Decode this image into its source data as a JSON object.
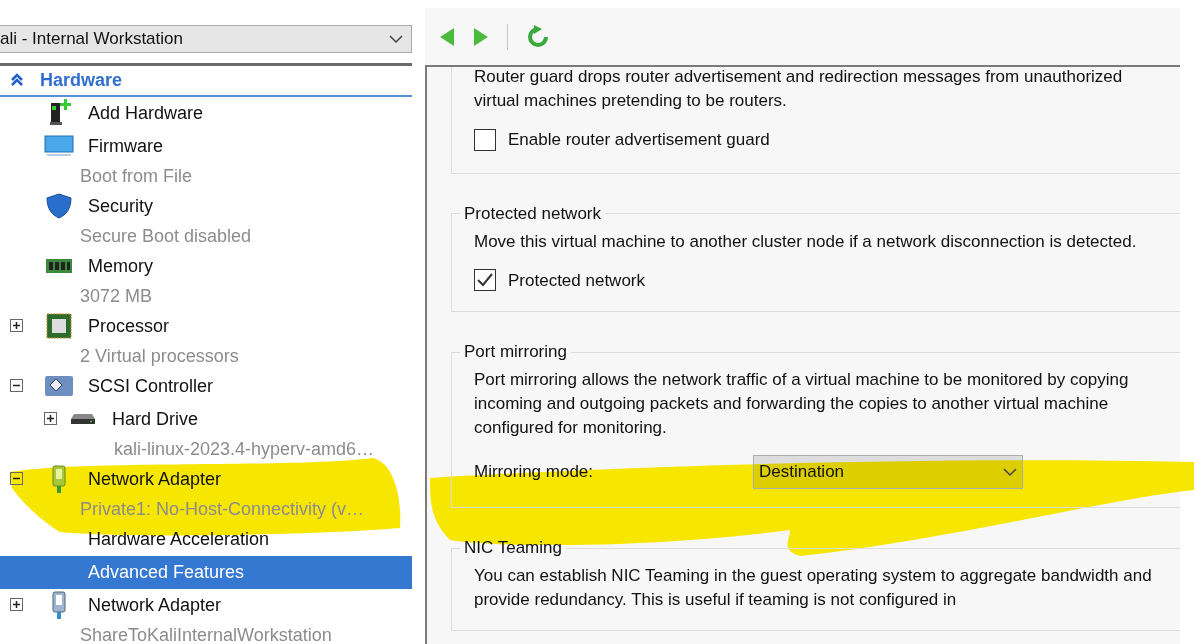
{
  "vm_selector": {
    "value": "ali - Internal Workstation"
  },
  "tree": {
    "section": {
      "label": "Hardware",
      "expanded": true
    },
    "items": [
      {
        "kind": "add-hardware",
        "label": "Add Hardware",
        "selected": false
      },
      {
        "kind": "firmware",
        "label": "Firmware",
        "detail": "Boot from File",
        "selected": false
      },
      {
        "kind": "security",
        "label": "Security",
        "detail": "Secure Boot disabled",
        "selected": false
      },
      {
        "kind": "memory",
        "label": "Memory",
        "detail": "3072 MB",
        "selected": false
      },
      {
        "kind": "processor",
        "label": "Processor",
        "detail": "2 Virtual processors",
        "expanded": false,
        "selected": false
      },
      {
        "kind": "controller",
        "label": "SCSI Controller",
        "expanded": true,
        "selected": false,
        "children": [
          {
            "kind": "drive",
            "label": "Hard Drive",
            "detail": "kali-linux-2023.4-hyperv-amd6…",
            "expanded": false,
            "selected": false
          }
        ]
      },
      {
        "kind": "network-adapter",
        "label": "Network Adapter",
        "detail": "Private1: No-Host-Connectivity (v…",
        "expanded": true,
        "selected": false,
        "children": [
          {
            "kind": "setting",
            "label": "Hardware Acceleration",
            "selected": false
          },
          {
            "kind": "setting",
            "label": "Advanced Features",
            "selected": true
          }
        ]
      },
      {
        "kind": "network-adapter",
        "label": "Network Adapter",
        "detail": "ShareToKaliInternalWorkstation",
        "expanded": false,
        "selected": false
      }
    ]
  },
  "settings": {
    "groups": [
      {
        "description": "Router guard drops router advertisement and redirection messages from unauthorized virtual machines pretending to be routers.",
        "controls": [
          {
            "kind": "checkbox",
            "label": "Enable router advertisement guard",
            "checked": false
          }
        ]
      },
      {
        "legend": "Protected network",
        "description": "Move this virtual machine to another cluster node if a network disconnection is detected.",
        "controls": [
          {
            "kind": "checkbox",
            "label": "Protected network",
            "checked": true
          }
        ]
      },
      {
        "legend": "Port mirroring",
        "description": "Port mirroring allows the network traffic of a virtual machine to be monitored by copying incoming and outgoing packets and forwarding the copies to another virtual machine configured for monitoring.",
        "controls": [
          {
            "kind": "dropdown",
            "label": "Mirroring mode:",
            "value": "Destination"
          }
        ]
      },
      {
        "legend": "NIC Teaming",
        "description": "You can establish NIC Teaming in the guest operating system to aggregate bandwidth and provide redundancy. This is useful if teaming is not configured in"
      }
    ]
  }
}
